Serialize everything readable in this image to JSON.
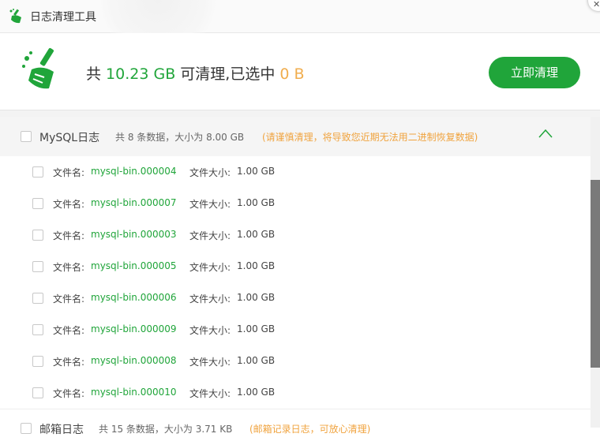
{
  "window": {
    "title": "日志清理工具"
  },
  "summary": {
    "prefix": "共 ",
    "total": "10.23 GB",
    "middle": " 可清理,已选中 ",
    "selected": "0 B",
    "button_label": "立即清理"
  },
  "groups": [
    {
      "name": "MySQL日志",
      "info": "共 8 条数据，大小为 8.00 GB",
      "warning": "(请谨慎清理，将导致您近期无法用二进制恢复数据)",
      "expanded": true
    },
    {
      "name": "邮箱日志",
      "info": "共 15 条数据，大小为 3.71 KB",
      "warning": "(邮箱记录日志，可放心清理)",
      "expanded": false
    }
  ],
  "rows_labels": {
    "file_label": "文件名:",
    "size_label": "文件大小:"
  },
  "files": [
    {
      "name": "mysql-bin.000004",
      "size": "1.00 GB"
    },
    {
      "name": "mysql-bin.000007",
      "size": "1.00 GB"
    },
    {
      "name": "mysql-bin.000003",
      "size": "1.00 GB"
    },
    {
      "name": "mysql-bin.000005",
      "size": "1.00 GB"
    },
    {
      "name": "mysql-bin.000006",
      "size": "1.00 GB"
    },
    {
      "name": "mysql-bin.000009",
      "size": "1.00 GB"
    },
    {
      "name": "mysql-bin.000008",
      "size": "1.00 GB"
    },
    {
      "name": "mysql-bin.000010",
      "size": "1.00 GB"
    }
  ],
  "colors": {
    "accent": "#20a53a",
    "warning": "#f0a33e",
    "selected": "#f0ad4e"
  },
  "icons": {
    "app": "broom-icon",
    "close": "close-icon",
    "collapse": "chevron-up-icon"
  }
}
